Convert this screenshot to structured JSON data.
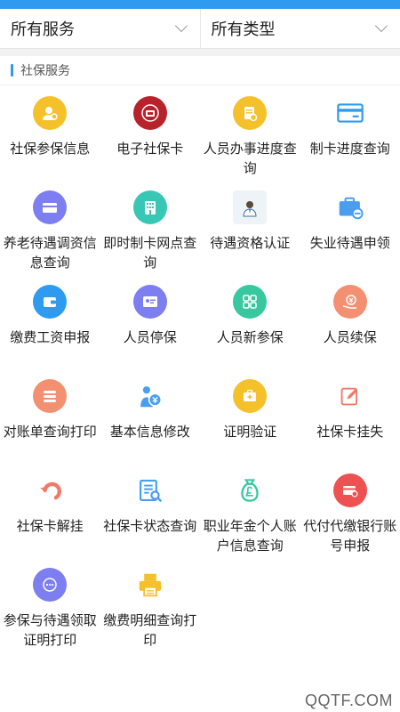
{
  "filters": {
    "service": "所有服务",
    "type": "所有类型"
  },
  "section": {
    "title": "社保服务"
  },
  "services": [
    {
      "label": "社保参保信息"
    },
    {
      "label": "电子社保卡"
    },
    {
      "label": "人员办事进度查询"
    },
    {
      "label": "制卡进度查询"
    },
    {
      "label": "养老待遇调资信息查询"
    },
    {
      "label": "即时制卡网点查询"
    },
    {
      "label": "待遇资格认证"
    },
    {
      "label": "失业待遇申领"
    },
    {
      "label": "缴费工资申报"
    },
    {
      "label": "人员停保"
    },
    {
      "label": "人员新参保"
    },
    {
      "label": "人员续保"
    },
    {
      "label": "对账单查询打印"
    },
    {
      "label": "基本信息修改"
    },
    {
      "label": "证明验证"
    },
    {
      "label": "社保卡挂失"
    },
    {
      "label": "社保卡解挂"
    },
    {
      "label": "社保卡状态查询"
    },
    {
      "label": "职业年金个人账户信息查询"
    },
    {
      "label": "代付代缴银行账号申报"
    },
    {
      "label": "参保与待遇领取证明打印"
    },
    {
      "label": "缴费明细查询打印"
    }
  ],
  "watermark": "QQTF.COM",
  "colors": {
    "accent": "#2f9bf0"
  }
}
